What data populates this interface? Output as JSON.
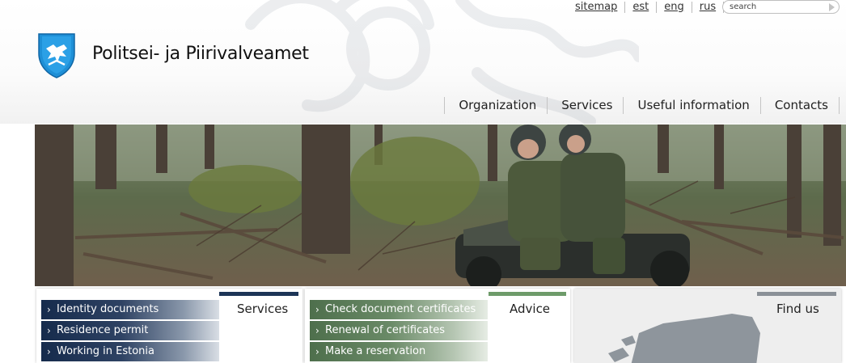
{
  "site": {
    "title": "Politsei- ja Piirivalveamet"
  },
  "utility_links": [
    "sitemap",
    "est",
    "eng",
    "rus"
  ],
  "search": {
    "placeholder": "search"
  },
  "nav": [
    "Organization",
    "Services",
    "Useful information",
    "Contacts"
  ],
  "boxes": {
    "services": {
      "title": "Services",
      "accent": "#1d3557",
      "links": [
        "Identity documents",
        "Residence permit",
        "Working in Estonia"
      ]
    },
    "advice": {
      "title": "Advice",
      "accent": "#6e9b6a",
      "links": [
        "Check document certificates",
        "Renewal of certificates",
        "Make a reservation"
      ]
    },
    "findus": {
      "title": "Find us",
      "accent": "#8a9097"
    }
  },
  "icons": {
    "logo": "coat-of-arms-lion-icon",
    "search": "arrow-right-icon",
    "link": "chevron-right-icon"
  }
}
